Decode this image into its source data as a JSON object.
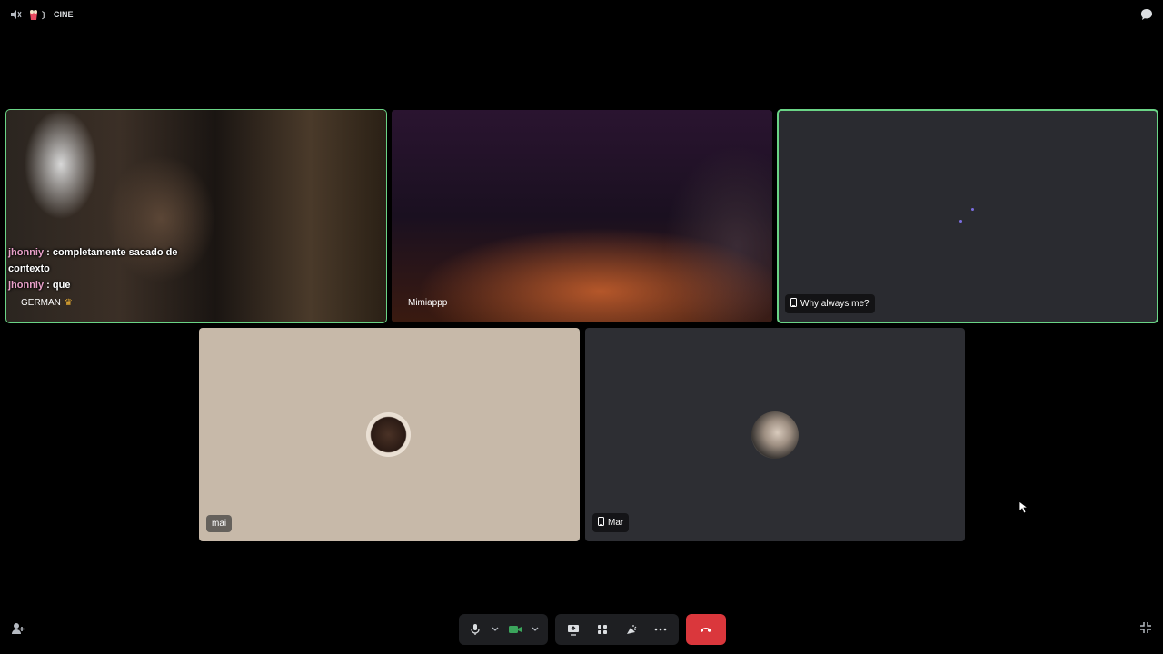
{
  "topbar": {
    "channel_name": "CINE",
    "volume_icon": "speaker-icon",
    "channel_icon": "popcorn-icon",
    "chat_icon": "chat-bubble-icon"
  },
  "tiles": [
    {
      "id": "german",
      "name": "GERMAN",
      "speaking": true,
      "badge": "crown-icon",
      "chat_overlay": [
        {
          "user": "jhonniy",
          "text": " : completamente sacado de contexto"
        },
        {
          "user": "jhonniy",
          "text": " : que"
        }
      ]
    },
    {
      "id": "mimiappp",
      "name": "Mimiappp",
      "speaking": false
    },
    {
      "id": "why-always-me",
      "name": "Why always me?",
      "speaking": true,
      "device": "mobile-icon"
    },
    {
      "id": "mai",
      "name": "mai",
      "speaking": false
    },
    {
      "id": "mar",
      "name": "Mar",
      "speaking": false,
      "device": "mobile-icon"
    }
  ],
  "controls": {
    "mic_icon": "microphone-icon",
    "camera_icon": "camera-icon",
    "share_icon": "screen-share-icon",
    "activity_icon": "activities-icon",
    "soundboard_icon": "soundboard-icon",
    "more_icon": "more-icon",
    "hangup_icon": "hangup-icon"
  },
  "colors": {
    "speaking_outline": "#6ad486",
    "hangup": "#da373c",
    "camera_active": "#3ba55c",
    "chat_user": "#e8a0c8"
  }
}
